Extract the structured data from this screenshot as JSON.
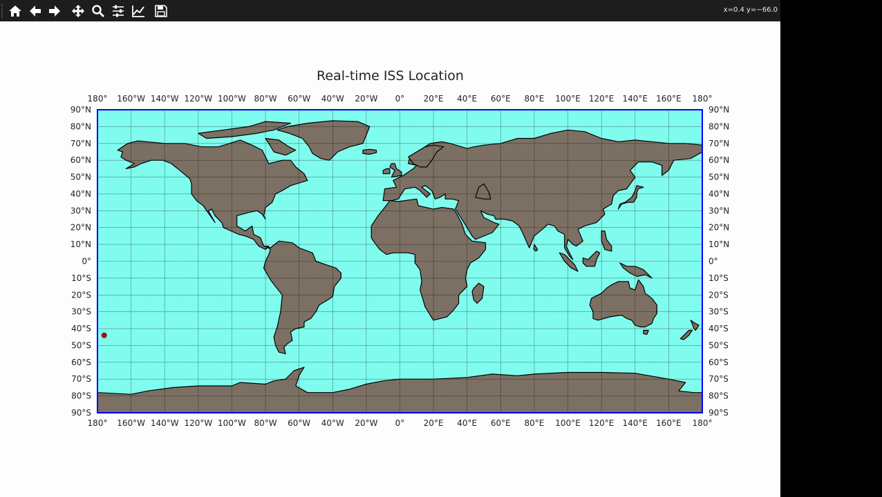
{
  "toolbar": {
    "buttons": [
      {
        "name": "home-button",
        "icon": "home-icon",
        "tooltip": "Reset original view"
      },
      {
        "name": "back-button",
        "icon": "arrow-left-icon",
        "tooltip": "Back"
      },
      {
        "name": "forward-button",
        "icon": "arrow-right-icon",
        "tooltip": "Forward"
      },
      {
        "name": "pan-button",
        "icon": "move-icon",
        "tooltip": "Pan"
      },
      {
        "name": "zoom-button",
        "icon": "magnifier-icon",
        "tooltip": "Zoom"
      },
      {
        "name": "configure-subplots-button",
        "icon": "sliders-icon",
        "tooltip": "Configure subplots"
      },
      {
        "name": "edit-axis-button",
        "icon": "line-chart-icon",
        "tooltip": "Edit axis"
      },
      {
        "name": "save-button",
        "icon": "floppy-disk-icon",
        "tooltip": "Save"
      }
    ],
    "coords_text": "x=0.4 y=−66.0"
  },
  "map": {
    "title": "Real-time ISS Location",
    "projection": "cylindrical",
    "lon_range": [
      -180,
      180
    ],
    "lat_range": [
      -90,
      90
    ],
    "lon_labels": [
      "180°",
      "160°W",
      "140°W",
      "120°W",
      "100°W",
      "80°W",
      "60°W",
      "40°W",
      "20°W",
      "0°",
      "20°E",
      "40°E",
      "60°E",
      "80°E",
      "100°E",
      "120°E",
      "140°E",
      "160°E",
      "180°"
    ],
    "lat_labels": [
      "90°N",
      "80°N",
      "70°N",
      "60°N",
      "50°N",
      "40°N",
      "30°N",
      "20°N",
      "10°N",
      "0°",
      "10°S",
      "20°S",
      "30°S",
      "40°S",
      "50°S",
      "60°S",
      "70°S",
      "80°S",
      "90°S"
    ],
    "grid": true,
    "colors": {
      "ocean": "#80fcee",
      "land": "#7b7063",
      "coast": "#000000",
      "border": "#0000ff",
      "marker": "#cc0000"
    },
    "iss_marker": {
      "lon": -176,
      "lat": -44
    }
  }
}
